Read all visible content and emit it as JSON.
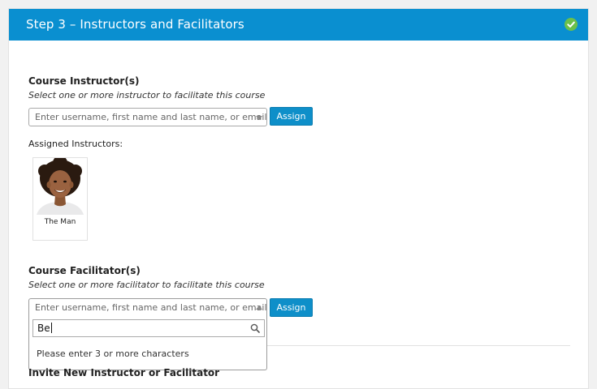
{
  "step": {
    "title": "Step 3 – Instructors and Facilitators",
    "completed": true,
    "header_color": "#0a8fd0",
    "check_color": "#6cc04a"
  },
  "instructors": {
    "title": "Course Instructor(s)",
    "description": "Select one or more instructor to facilitate this course",
    "select_placeholder": "Enter username, first name and last name, or email",
    "assign_label": "Assign",
    "assigned_label": "Assigned Instructors:",
    "assigned": [
      {
        "name": "The Man",
        "avatar_icon": "person-avatar"
      }
    ]
  },
  "facilitators": {
    "title": "Course Facilitator(s)",
    "description": "Select one or more facilitator to facilitate this course",
    "select_placeholder": "Enter username, first name and last name, or email",
    "assign_label": "Assign",
    "dropdown_open": true,
    "search_value": "Be",
    "search_message": "Please enter 3 or more characters"
  },
  "invite": {
    "title": "Invite New Instructor or Facilitator"
  },
  "accent_color": "#0e8fc9"
}
